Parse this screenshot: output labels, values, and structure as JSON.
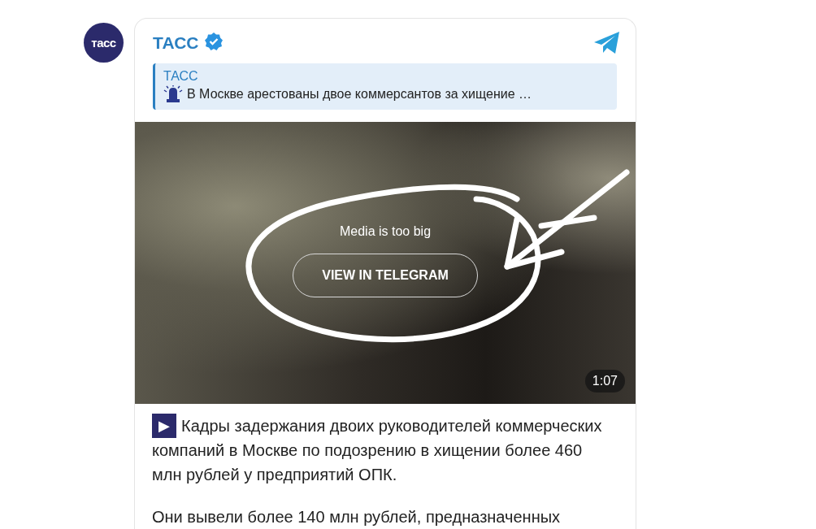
{
  "channel": {
    "avatar_text": "тасс",
    "name": "ТАСС",
    "verified": true
  },
  "reply": {
    "author": "ТАСС",
    "text": "В Москве арестованы двое коммерсантов за хищение …"
  },
  "media": {
    "notice": "Media is too big",
    "button": "VIEW IN TELEGRAM",
    "duration": "1:07"
  },
  "body": {
    "lead_icon": "▶",
    "paragraphs": [
      "Кадры задержания двоих руководителей коммерческих компаний в Москве по подозрению в хищении более 460 млн рублей у предприятий ОПК.",
      "Они вывели более 140 млн рублей, предназначенных"
    ]
  }
}
